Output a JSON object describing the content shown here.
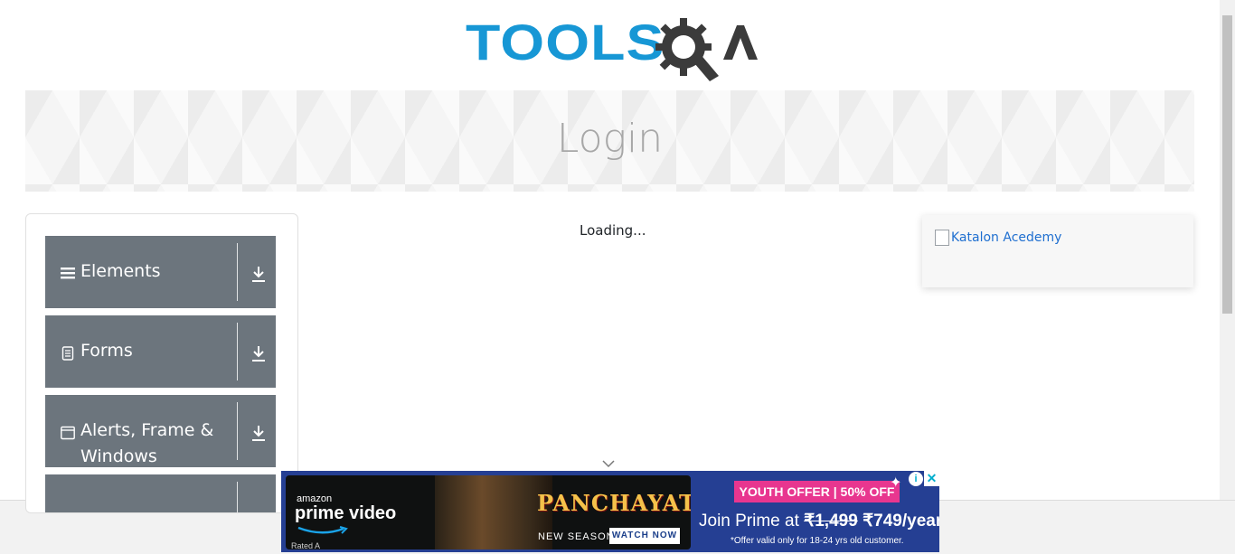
{
  "header": {
    "logo_text": "TOOLS",
    "logo_suffix": "A"
  },
  "banner": {
    "title": "Login"
  },
  "sidebar": {
    "groups": [
      {
        "label": "Elements",
        "icon": "hamburger-icon"
      },
      {
        "label": "Forms",
        "icon": "document-icon"
      },
      {
        "label": "Alerts, Frame & Windows",
        "icon": "window-icon"
      },
      {
        "label": "",
        "icon": ""
      }
    ]
  },
  "main": {
    "loading_text": "Loading..."
  },
  "right_ad": {
    "alt_text": "Katalon Acedemy"
  },
  "bottom_ad": {
    "brand_small": "amazon",
    "brand_big": "prime video",
    "rated": "Rated A",
    "show_title": "PANCHAYAT",
    "season_text": "NEW SEASON",
    "watch_button": "WATCH NOW",
    "youth_offer": "YOUTH OFFER | 50% OFF",
    "join_prefix": "Join Prime at ",
    "old_price": "₹1,499",
    "new_price": "₹749/year*",
    "offer_note": "*Offer valid only for 18-24 yrs old customer.",
    "info_glyph": "i",
    "close_glyph": "✕"
  },
  "colors": {
    "accent_blue": "#1797d5",
    "menu_gray": "#6c757d",
    "ad_blue": "#253f93",
    "offer_pink": "#e8368f"
  }
}
